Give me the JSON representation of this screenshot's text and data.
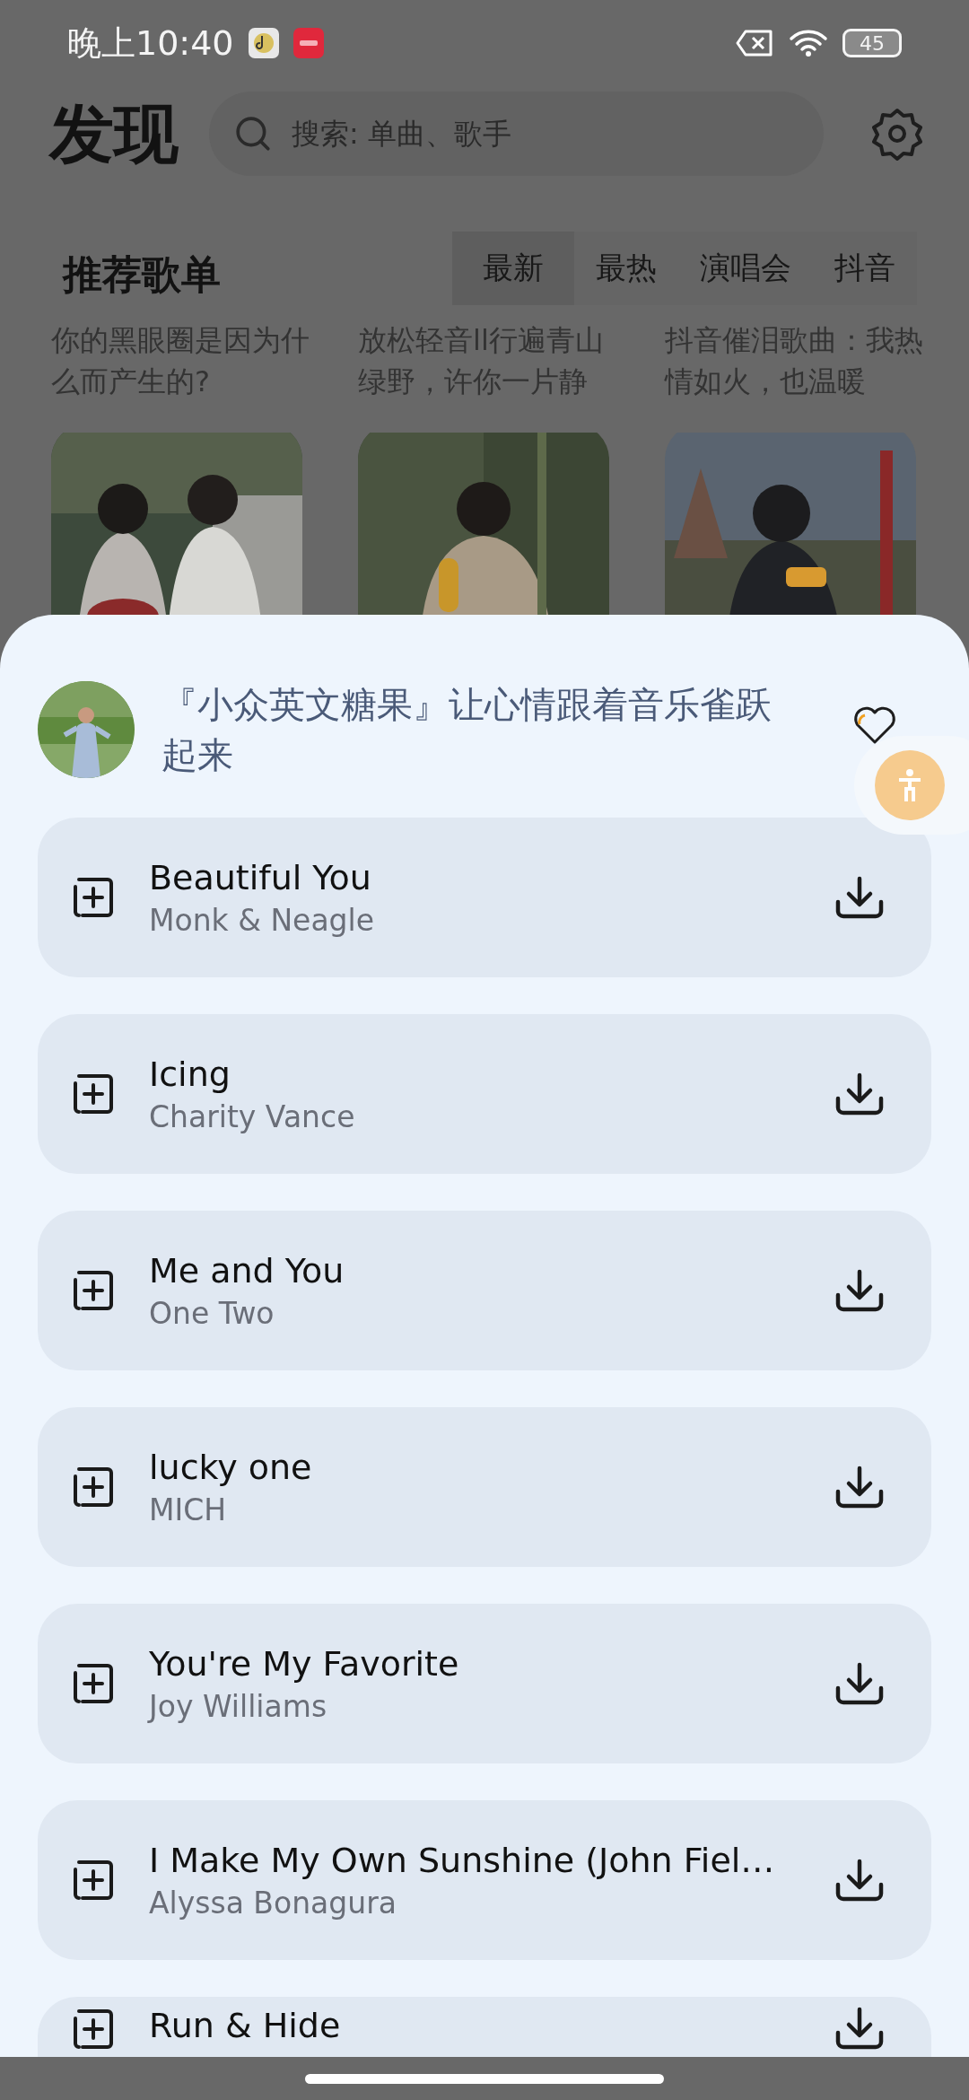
{
  "status_bar": {
    "time": "晚上10:40",
    "battery": "45"
  },
  "header": {
    "title": "发现",
    "search": {
      "placeholder": "搜索: 单曲、歌手"
    }
  },
  "section": {
    "title": "推荐歌单",
    "tabs": [
      {
        "label": "最新",
        "selected": true
      },
      {
        "label": "最热",
        "selected": false
      },
      {
        "label": "演唱会",
        "selected": false
      },
      {
        "label": "抖音",
        "selected": false
      }
    ]
  },
  "playlists": [
    {
      "title": "你的黑眼圈是因为什么而产生的?",
      "kind": "picture"
    },
    {
      "title": "放松轻音ll行遍青山绿野，许你一片静",
      "kind": "picture"
    },
    {
      "title": "抖音催泪歌曲：我热情如火，也温暖",
      "kind": "picture"
    }
  ],
  "sheet": {
    "title": "『小众英文糖果』让心情跟着音乐雀跃起来",
    "songs": [
      {
        "title": "Beautiful You",
        "artist": "Monk & Neagle"
      },
      {
        "title": "Icing",
        "artist": "Charity Vance"
      },
      {
        "title": "Me and You",
        "artist": "One Two"
      },
      {
        "title": "lucky one",
        "artist": "MICH"
      },
      {
        "title": "You're My Favorite",
        "artist": "Joy Williams"
      },
      {
        "title": "I Make My Own Sunshine (John Fiel…",
        "artist": "Alyssa Bonagura"
      },
      {
        "title": "Run & Hide"
      }
    ]
  }
}
